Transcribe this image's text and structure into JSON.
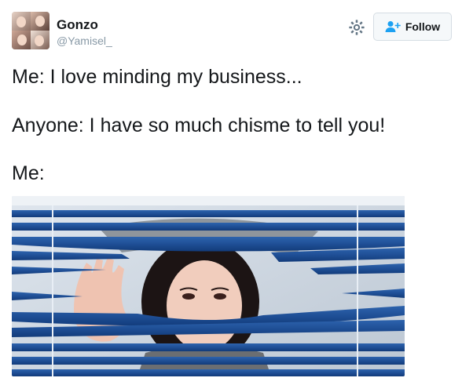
{
  "user": {
    "name": "Gonzo",
    "handle": "@Yamisel_"
  },
  "actions": {
    "settings_icon": "gear-icon",
    "follow_label": "Follow",
    "follow_icon": "add-user-icon",
    "accent": "#1da1f2"
  },
  "tweet": {
    "lines": [
      "Me: I love minding my business...",
      "Anyone: I have so much chisme to tell you!",
      "Me:"
    ]
  },
  "media": {
    "kind": "photo",
    "colors": {
      "blinds": "#1f4f96",
      "blinds_dark": "#123b7a",
      "skin": "#f1cdbd",
      "hair": "#1c1414"
    }
  }
}
